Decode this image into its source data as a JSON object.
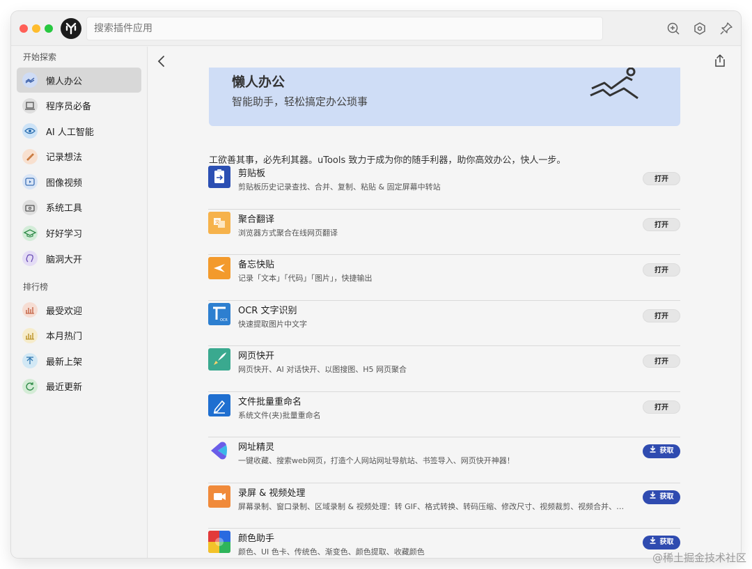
{
  "search": {
    "placeholder": "搜索插件应用"
  },
  "sidebar": {
    "section_explore": "开始探索",
    "explore_items": [
      {
        "label": "懒人办公",
        "icon": "lazy-office-icon",
        "color": "#cfdcf5"
      },
      {
        "label": "程序员必备",
        "icon": "laptop-icon",
        "color": "#dedede"
      },
      {
        "label": "AI 人工智能",
        "icon": "eye-icon",
        "color": "#cde3f7"
      },
      {
        "label": "记录想法",
        "icon": "pencil-icon",
        "color": "#f8e0cf"
      },
      {
        "label": "图像视频",
        "icon": "video-icon",
        "color": "#d9e5f6"
      },
      {
        "label": "系统工具",
        "icon": "toolbox-icon",
        "color": "#dedede"
      },
      {
        "label": "好好学习",
        "icon": "graduation-cap-icon",
        "color": "#d3ecd8"
      },
      {
        "label": "脑洞大开",
        "icon": "brain-icon",
        "color": "#e4dcf5"
      }
    ],
    "section_ranking": "排行榜",
    "ranking_items": [
      {
        "label": "最受欢迎",
        "icon": "bar-chart-icon",
        "color": "#f6ddd3"
      },
      {
        "label": "本月热门",
        "icon": "bar-chart-icon",
        "color": "#f6eccb"
      },
      {
        "label": "最新上架",
        "icon": "upload-icon",
        "color": "#d2e8f5"
      },
      {
        "label": "最近更新",
        "icon": "refresh-icon",
        "color": "#d4ecd6"
      }
    ]
  },
  "banner": {
    "title": "懒人办公",
    "subtitle": "智能助手，轻松搞定办公琐事"
  },
  "intro": "工欲善其事，必先利其器。uTools 致力于成为你的随手利器，助你高效办公，快人一步。",
  "apps": [
    {
      "name": "剪贴板",
      "desc": "剪贴板历史记录查找、合并、复制、粘贴 & 固定屏幕中转站",
      "action": "打开",
      "icon": "clipboard-icon"
    },
    {
      "name": "聚合翻译",
      "desc": "浏览器方式聚合在线网页翻译",
      "action": "打开",
      "icon": "translate-icon"
    },
    {
      "name": "备忘快贴",
      "desc": "记录「文本」「代码」「图片」，快捷输出",
      "action": "打开",
      "icon": "star-note-icon"
    },
    {
      "name": "OCR 文字识别",
      "desc": "快速提取图片中文字",
      "action": "打开",
      "icon": "ocr-icon"
    },
    {
      "name": "网页快开",
      "desc": "网页快开、AI 对话快开、以图搜图、H5 网页聚合",
      "action": "打开",
      "icon": "rocket-icon"
    },
    {
      "name": "文件批量重命名",
      "desc": "系统文件(夹)批量重命名",
      "action": "打开",
      "icon": "rename-pen-icon"
    },
    {
      "name": "网址精灵",
      "desc": "一键收藏、搜索web网页，打造个人网站网址导航站、书签导入、网页快开神器！",
      "action": "获取",
      "icon": "url-sprite-icon"
    },
    {
      "name": "录屏 & 视频处理",
      "desc": "屏幕录制、窗口录制、区域录制 & 视频处理：转 GIF、格式转换、转码压缩、修改尺寸、视频裁剪、视频合并、视频…",
      "action": "获取",
      "icon": "screen-record-icon"
    },
    {
      "name": "颜色助手",
      "desc": "颜色、UI 色卡、传统色、渐变色、颜色提取、收藏颜色",
      "action": "获取",
      "icon": "color-palette-icon"
    }
  ],
  "watermark": "@稀土掘金技术社区"
}
